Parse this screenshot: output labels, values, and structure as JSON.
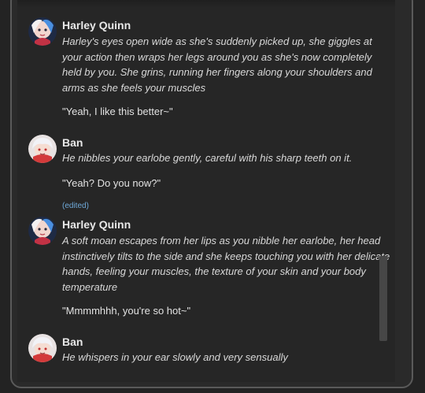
{
  "messages": [
    {
      "author": "Harley Quinn",
      "avatar_icon": "harley-avatar-icon",
      "narration": "Harley's eyes open wide as she's suddenly picked up, she giggles at your action then wraps her legs around you as she's now completely held by you. She grins, running her fingers along your shoulders and arms as she feels your muscles",
      "quote": "\"Yeah, I like this better~\""
    },
    {
      "author": "Ban",
      "avatar_icon": "ban-avatar-icon",
      "narration": "He nibbles your earlobe gently, careful with his sharp teeth on it.",
      "quote": "\"Yeah? Do you now?\"",
      "edited_label": "(edited)"
    },
    {
      "author": "Harley Quinn",
      "avatar_icon": "harley-avatar-icon",
      "narration": "A soft moan escapes from her lips as you nibble her earlobe, her head instinctively tilts to the side and she keeps touching you with her delicate hands, feeling your muscles, the texture of your skin and your body temperature",
      "quote": "\"Mmmmhhh, you're so hot~\""
    },
    {
      "author": "Ban",
      "avatar_icon": "ban-avatar-icon",
      "narration": "He whispers in your ear slowly and very sensually"
    }
  ],
  "colors": {
    "background": "#262626",
    "text": "#d8d8d8",
    "edited": "#6ea8d8"
  }
}
